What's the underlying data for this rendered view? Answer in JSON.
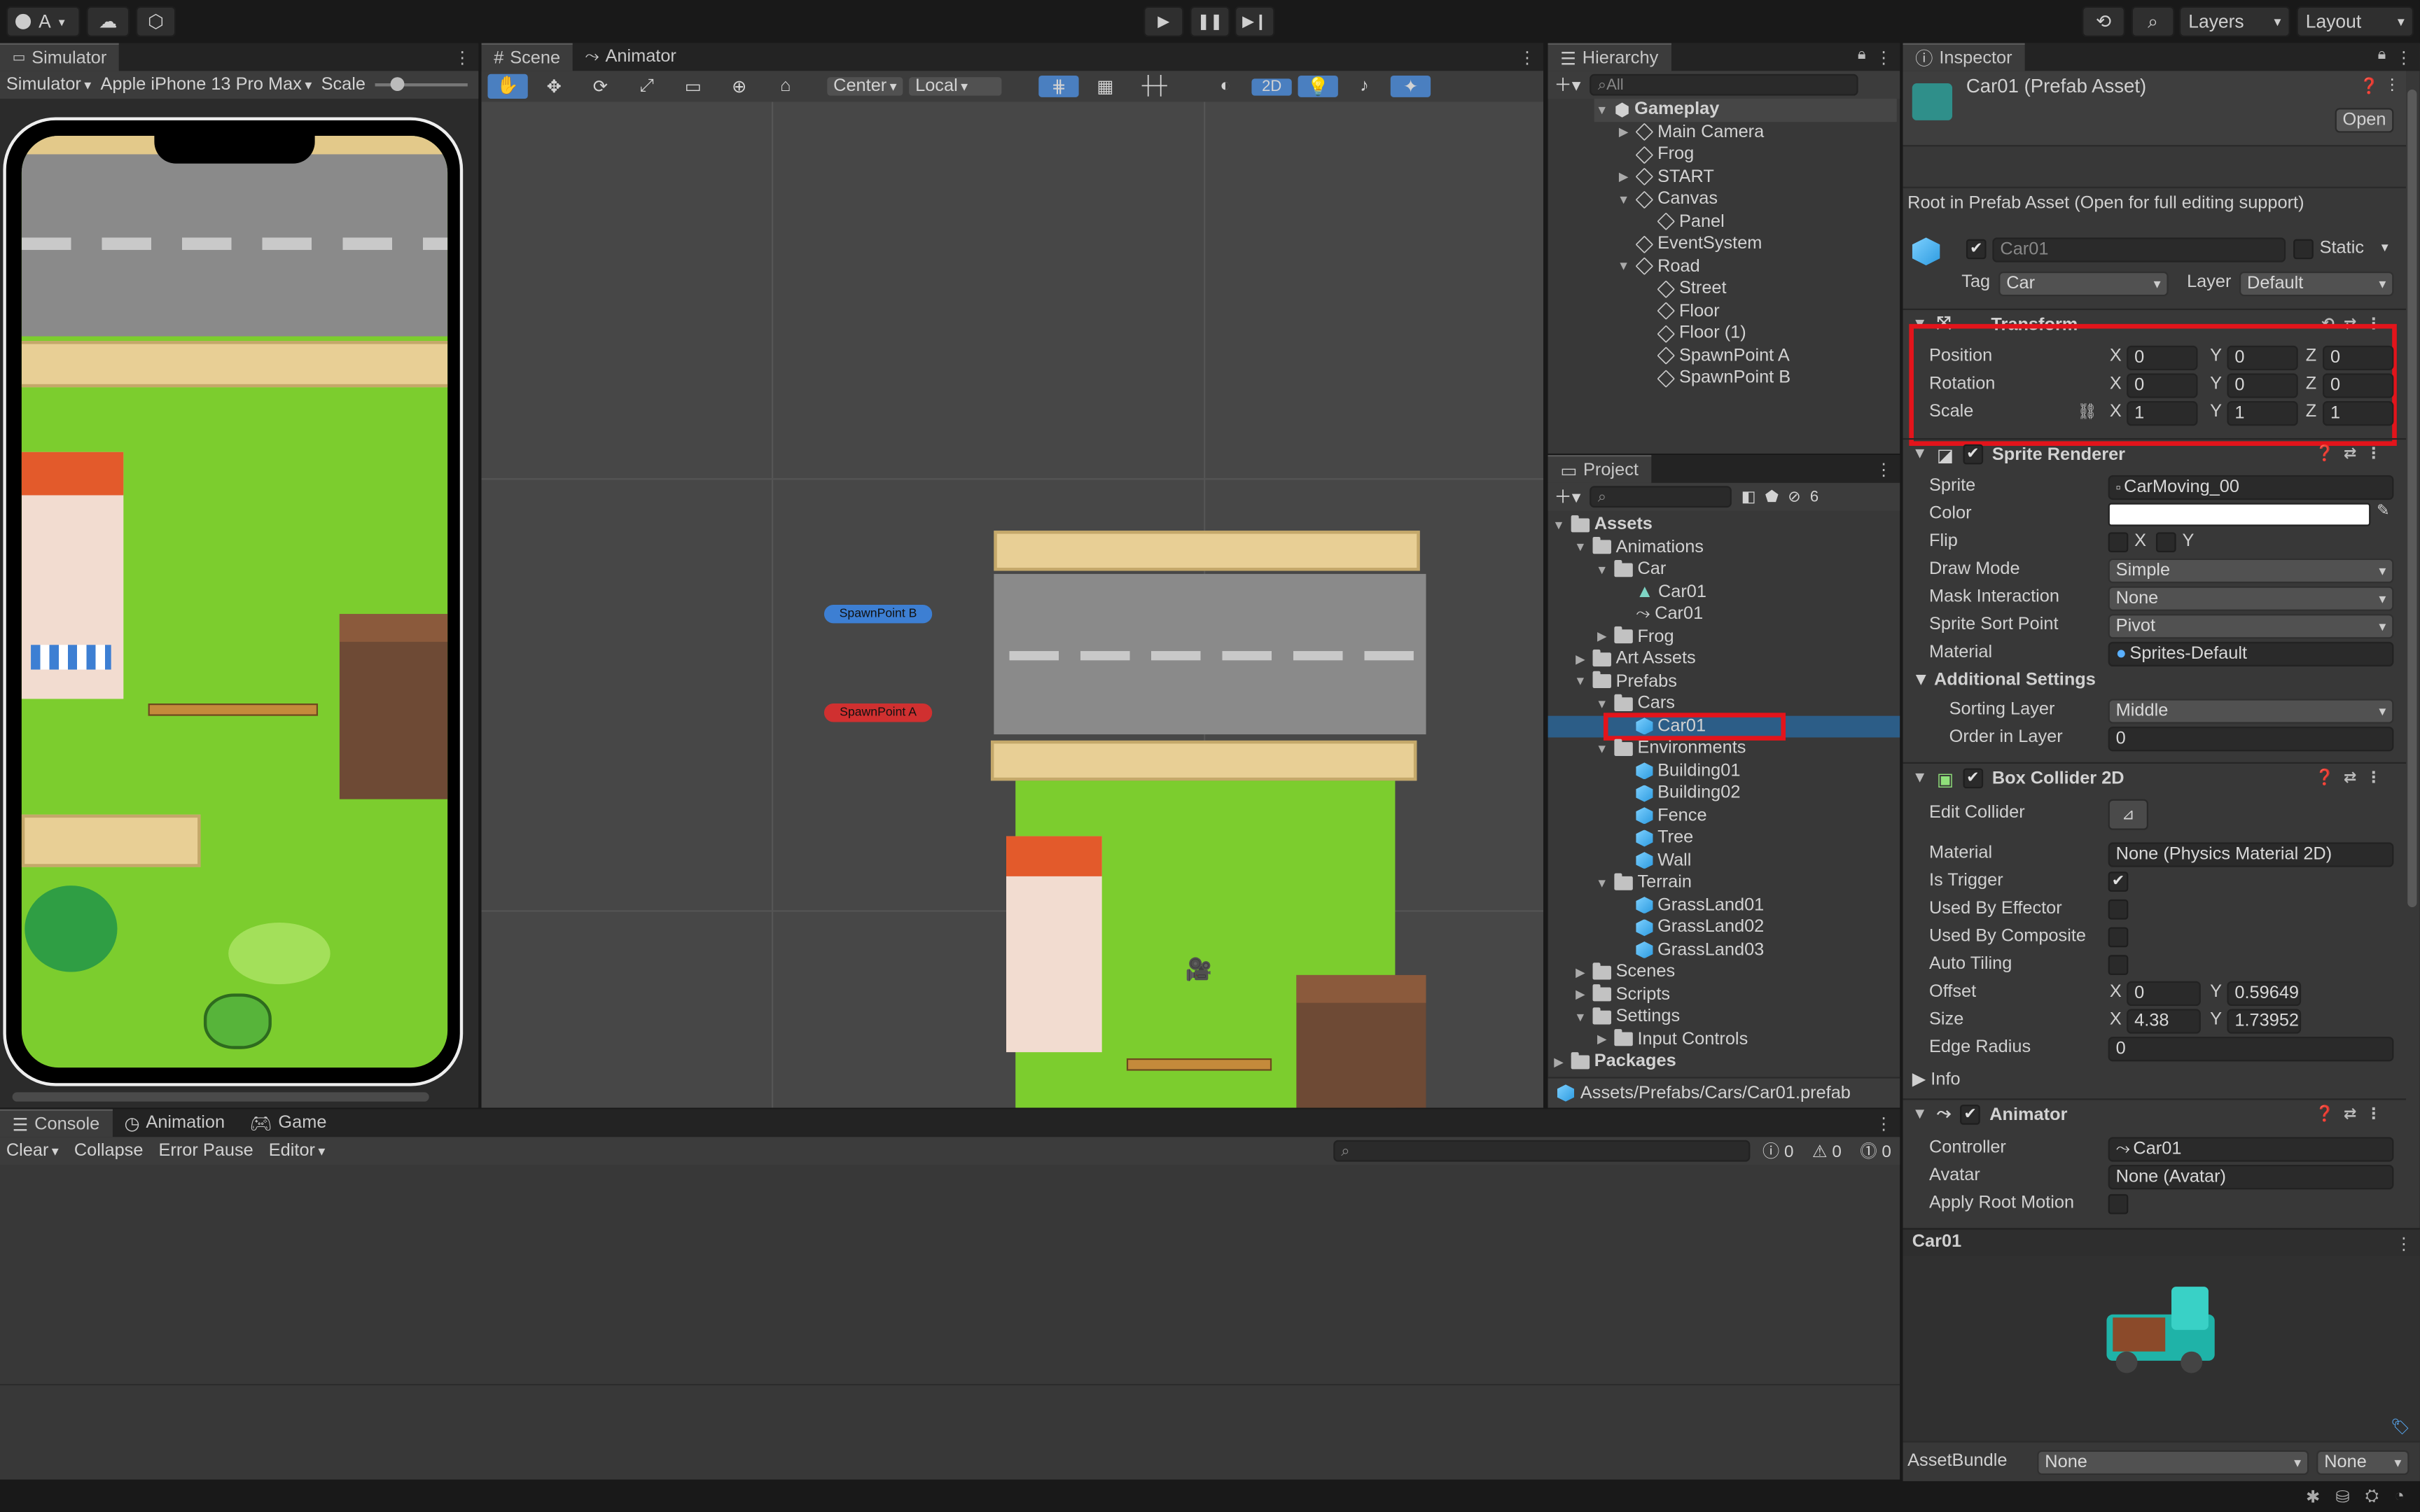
{
  "toolbar": {
    "account": "A",
    "play_icon": "play-icon",
    "pause_icon": "pause-icon",
    "step_icon": "step-icon",
    "layers": "Layers",
    "layout": "Layout"
  },
  "simulator": {
    "tab": "Simulator",
    "mode": "Simulator",
    "device": "Apple iPhone 13 Pro Max",
    "scale_label": "Scale"
  },
  "scene": {
    "tab_scene": "Scene",
    "tab_animator": "Animator",
    "pivot": "Center",
    "space": "Local",
    "mode_2d": "2D",
    "spawn_b": "SpawnPoint B",
    "spawn_a": "SpawnPoint A"
  },
  "hierarchy": {
    "tab": "Hierarchy",
    "search_placeholder": "All",
    "scene_name": "Gameplay",
    "items": [
      "Main Camera",
      "Frog",
      "START",
      "Canvas",
      "Panel",
      "EventSystem",
      "Road",
      "Street",
      "Floor",
      "Floor (1)",
      "SpawnPoint A",
      "SpawnPoint B"
    ]
  },
  "project": {
    "tab": "Project",
    "hidden_count": "6",
    "items": [
      "Assets",
      "Animations",
      "Car",
      "Car01",
      "Car01",
      "Frog",
      "Art Assets",
      "Prefabs",
      "Cars",
      "Car01",
      "Environments",
      "Building01",
      "Building02",
      "Fence",
      "Tree",
      "Wall",
      "Terrain",
      "GrassLand01",
      "GrassLand02",
      "GrassLand03",
      "Scenes",
      "Scripts",
      "Settings",
      "Input Controls",
      "Packages"
    ],
    "path": "Assets/Prefabs/Cars/Car01.prefab"
  },
  "console": {
    "tabs": [
      "Console",
      "Animation",
      "Game"
    ],
    "clear": "Clear",
    "collapse": "Collapse",
    "error_pause": "Error Pause",
    "editor": "Editor",
    "count_info": "0",
    "count_warn": "0",
    "count_error": "0"
  },
  "inspector": {
    "tab": "Inspector",
    "title": "Car01 (Prefab Asset)",
    "open": "Open",
    "note": "Root in Prefab Asset (Open for full editing support)",
    "object_name": "Car01",
    "static": "Static",
    "tag_label": "Tag",
    "tag": "Car",
    "layer_label": "Layer",
    "layer": "Default",
    "transform": {
      "title": "Transform",
      "position_label": "Position",
      "px": "0",
      "py": "0",
      "pz": "0",
      "rotation_label": "Rotation",
      "rx": "0",
      "ry": "0",
      "rz": "0",
      "scale_label": "Scale",
      "sx": "1",
      "sy": "1",
      "sz": "1"
    },
    "sprite_renderer": {
      "title": "Sprite Renderer",
      "sprite_label": "Sprite",
      "sprite": "CarMoving_00",
      "color_label": "Color",
      "flip_label": "Flip",
      "flip_x": "X",
      "flip_y": "Y",
      "draw_mode_label": "Draw Mode",
      "draw_mode": "Simple",
      "mask_label": "Mask Interaction",
      "mask": "None",
      "sort_point_label": "Sprite Sort Point",
      "sort_point": "Pivot",
      "material_label": "Material",
      "material": "Sprites-Default",
      "additional": "Additional Settings",
      "sorting_layer_label": "Sorting Layer",
      "sorting_layer": "Middle",
      "order_label": "Order in Layer",
      "order": "0"
    },
    "box_collider": {
      "title": "Box Collider 2D",
      "edit_label": "Edit Collider",
      "material_label": "Material",
      "material": "None (Physics Material 2D)",
      "is_trigger_label": "Is Trigger",
      "effector_label": "Used By Effector",
      "composite_label": "Used By Composite",
      "auto_tiling_label": "Auto Tiling",
      "offset_label": "Offset",
      "offset_x": "0",
      "offset_y": "0.59649",
      "size_label": "Size",
      "size_x": "4.38",
      "size_y": "1.73952",
      "edge_label": "Edge Radius",
      "edge": "0",
      "info": "Info"
    },
    "animator": {
      "title": "Animator",
      "controller_label": "Controller",
      "controller": "Car01",
      "avatar_label": "Avatar",
      "avatar": "None (Avatar)",
      "root_motion_label": "Apply Root Motion"
    },
    "preview_title": "Car01",
    "assetbundle_label": "AssetBundle",
    "assetbundle": "None",
    "variant": "None"
  },
  "colors": {
    "selection": "#2c5d87",
    "highlight_box": "#e3141b",
    "panel": "#383838",
    "grass": "#7ccd2e"
  }
}
